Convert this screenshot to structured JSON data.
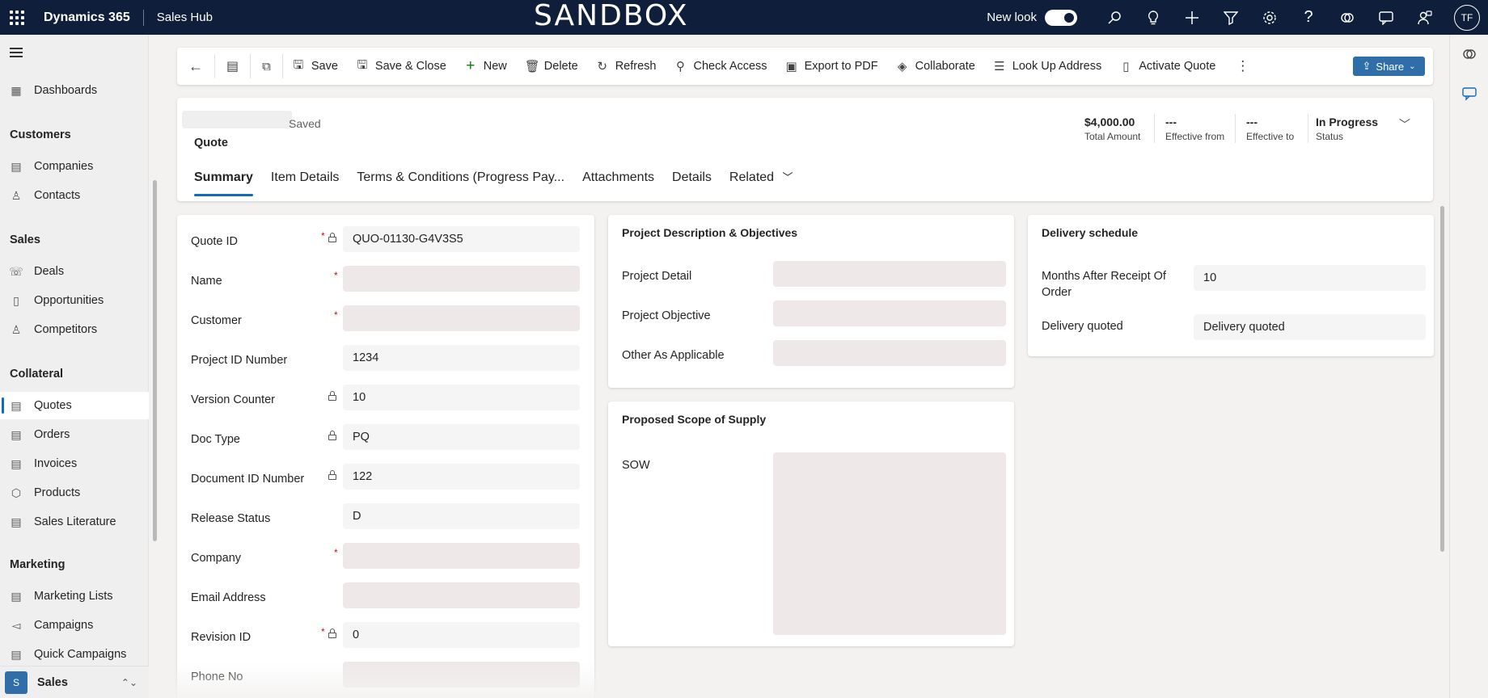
{
  "topbar": {
    "app_name": "Dynamics 365",
    "hub_name": "Sales Hub",
    "environment_banner": "SANDBOX",
    "new_look_label": "New look",
    "new_look_on": true,
    "avatar_initials": "TF",
    "icons": [
      "app-launcher-icon",
      "search-icon",
      "lightbulb-icon",
      "plus-icon",
      "filter-icon",
      "settings-icon",
      "help-icon",
      "copilot-icon",
      "chat-icon",
      "assistant-icon"
    ]
  },
  "sidebar": {
    "items_top": [
      {
        "label": "Dashboards",
        "icon": "dashboard-icon"
      }
    ],
    "groups": [
      {
        "title": "Customers",
        "items": [
          {
            "label": "Companies",
            "icon": "building-icon"
          },
          {
            "label": "Contacts",
            "icon": "person-icon"
          }
        ]
      },
      {
        "title": "Sales",
        "items": [
          {
            "label": "Deals",
            "icon": "deals-icon"
          },
          {
            "label": "Opportunities",
            "icon": "opportunity-icon"
          },
          {
            "label": "Competitors",
            "icon": "competitor-icon"
          }
        ]
      },
      {
        "title": "Collateral",
        "items": [
          {
            "label": "Quotes",
            "icon": "quote-icon",
            "active": true
          },
          {
            "label": "Orders",
            "icon": "order-icon"
          },
          {
            "label": "Invoices",
            "icon": "invoice-icon"
          },
          {
            "label": "Products",
            "icon": "product-icon"
          },
          {
            "label": "Sales Literature",
            "icon": "literature-icon"
          }
        ]
      },
      {
        "title": "Marketing",
        "items": [
          {
            "label": "Marketing Lists",
            "icon": "marketing-list-icon"
          },
          {
            "label": "Campaigns",
            "icon": "campaign-icon"
          },
          {
            "label": "Quick Campaigns",
            "icon": "quick-campaign-icon"
          }
        ]
      }
    ],
    "area": {
      "badge": "S",
      "label": "Sales"
    }
  },
  "commandbar": {
    "save": "Save",
    "save_close": "Save & Close",
    "new": "New",
    "delete": "Delete",
    "refresh": "Refresh",
    "check_access": "Check Access",
    "export_pdf": "Export to PDF",
    "collaborate": "Collaborate",
    "look_up_address": "Look Up Address",
    "activate_quote": "Activate Quote",
    "share": "Share"
  },
  "header": {
    "save_state": "Saved",
    "entity": "Quote",
    "total_amount_value": "$4,000.00",
    "total_amount_label": "Total Amount",
    "effective_from_value": "---",
    "effective_from_label": "Effective from",
    "effective_to_value": "---",
    "effective_to_label": "Effective to",
    "status_value": "In Progress",
    "status_label": "Status"
  },
  "tabs": [
    "Summary",
    "Item Details",
    "Terms & Conditions (Progress Pay...",
    "Attachments",
    "Details",
    "Related"
  ],
  "general": {
    "fields": [
      {
        "label": "Quote ID",
        "value": "QUO-01130-G4V3S5",
        "required": true,
        "locked": true
      },
      {
        "label": "Name",
        "value": "",
        "required": true,
        "locked": false,
        "redacted": true
      },
      {
        "label": "Customer",
        "value": "",
        "required": true,
        "locked": false,
        "redacted": true
      },
      {
        "label": "Project ID Number",
        "value": "1234",
        "required": false,
        "locked": false
      },
      {
        "label": "Version Counter",
        "value": "10",
        "required": false,
        "locked": true
      },
      {
        "label": "Doc Type",
        "value": "PQ",
        "required": false,
        "locked": true
      },
      {
        "label": "Document ID Number",
        "value": "122",
        "required": false,
        "locked": true
      },
      {
        "label": "Release Status",
        "value": "D",
        "required": false,
        "locked": false
      },
      {
        "label": "Company",
        "value": "",
        "required": true,
        "locked": false,
        "redacted": true
      },
      {
        "label": "Email Address",
        "value": "",
        "required": false,
        "locked": false,
        "redacted": true
      },
      {
        "label": "Revision ID",
        "value": "0",
        "required": true,
        "locked": true
      },
      {
        "label": "Phone No",
        "value": "",
        "required": false,
        "locked": false,
        "redacted": true
      }
    ]
  },
  "project": {
    "title": "Project Description & Objectives",
    "fields": [
      {
        "label": "Project Detail"
      },
      {
        "label": "Project Objective"
      },
      {
        "label": "Other As Applicable"
      }
    ]
  },
  "scope": {
    "title": "Proposed Scope of Supply",
    "sow_label": "SOW"
  },
  "delivery": {
    "title": "Delivery schedule",
    "months_label": "Months After Receipt Of Order",
    "months_value": "10",
    "quoted_label": "Delivery quoted",
    "quoted_value": "Delivery quoted"
  }
}
